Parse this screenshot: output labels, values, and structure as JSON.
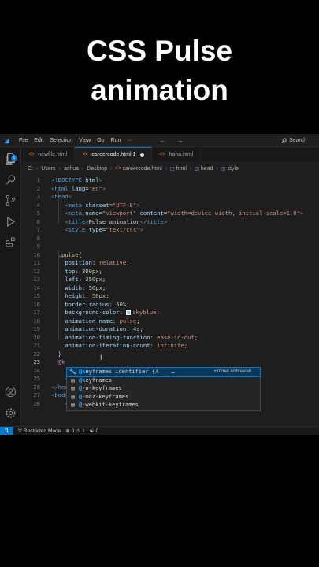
{
  "headline": {
    "line1": "CSS Pulse",
    "line2": "animation"
  },
  "menu": {
    "items": [
      "File",
      "Edit",
      "Selection",
      "View",
      "Go",
      "Run",
      "···"
    ],
    "nav_arrows": "← →",
    "search_label": "Search"
  },
  "activity": {
    "badge_count": "1"
  },
  "tabs": [
    {
      "label": "newfile.html",
      "active": false,
      "dirty": false
    },
    {
      "label": "careercode.html 1",
      "active": true,
      "dirty": true
    },
    {
      "label": "haha.html",
      "active": false,
      "dirty": false
    }
  ],
  "breadcrumb": [
    "C:",
    "Users",
    "ashua",
    "Desktop",
    "careercode.html",
    "html",
    "head",
    "style"
  ],
  "code": {
    "line_numbers": [
      "1",
      "2",
      "3",
      "4",
      "5",
      "6",
      "7",
      "8",
      "9",
      "10",
      "11",
      "12",
      "13",
      "14",
      "15",
      "16",
      "17",
      "18",
      "19",
      "20",
      "21",
      "22",
      "23",
      "24",
      "25",
      "26",
      "27",
      "28"
    ],
    "current_line": "23"
  },
  "suggest": {
    "items": [
      {
        "icon": "wrench-icon",
        "match": "@k",
        "rest": "eyframes identifier {⅄",
        "detail": "Emmet Abbreviati…",
        "selected": true
      },
      {
        "icon": "property-icon",
        "match": "@k",
        "rest": "eyframes",
        "detail": "",
        "selected": false
      },
      {
        "icon": "property-icon",
        "match": "@",
        "rest": "-o-keyframes",
        "detail": "",
        "selected": false
      },
      {
        "icon": "property-icon",
        "match": "@",
        "rest": "-moz-keyframes",
        "detail": "",
        "selected": false
      },
      {
        "icon": "property-icon",
        "match": "@",
        "rest": "-webkit-keyframes",
        "detail": "",
        "selected": false
      }
    ],
    "more": "…"
  },
  "status": {
    "remote_icon": "remote-icon",
    "mode": "Restricted Mode",
    "errors": "0",
    "warnings": "1",
    "ports": "0"
  },
  "colors": {
    "accent": "#0078d4",
    "editor_bg": "#1e1e1e",
    "swatch": "#87ceeb"
  }
}
